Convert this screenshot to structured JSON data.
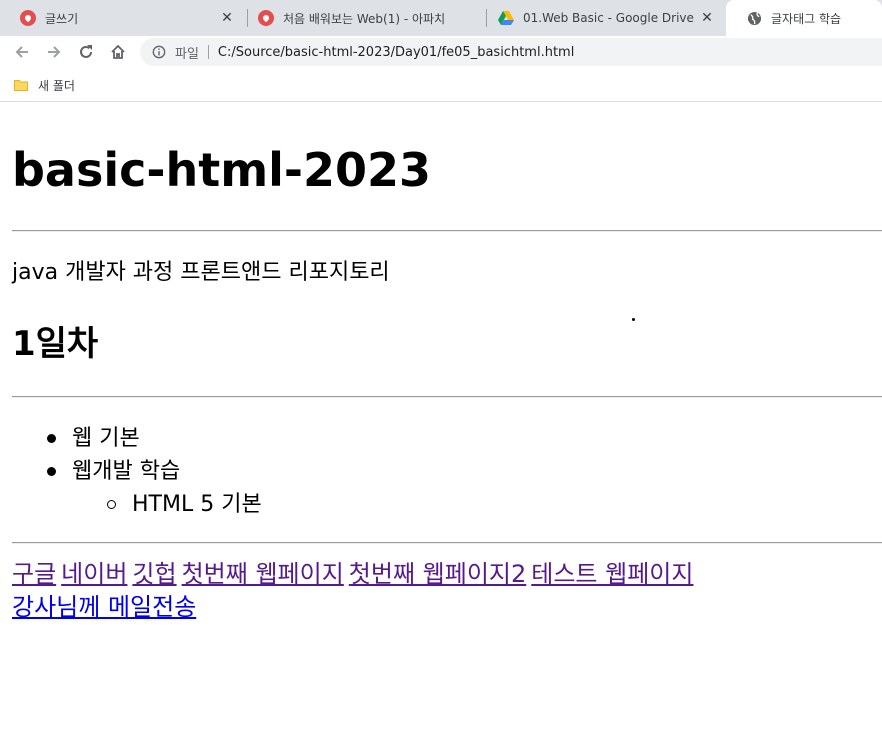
{
  "browser": {
    "tabs": [
      {
        "title": "글쓰기",
        "icon": "tistory-icon",
        "active": false
      },
      {
        "title": "처음 배워보는 Web(1) - 아파치",
        "icon": "tistory-icon",
        "active": false
      },
      {
        "title": "01.Web Basic - Google Drive",
        "icon": "google-drive-icon",
        "active": false
      },
      {
        "title": "글자태그 학습",
        "icon": "globe-icon",
        "active": true
      }
    ],
    "address": {
      "scheme": "파일",
      "url": "C:/Source/basic-html-2023/Day01/fe05_basichtml.html"
    },
    "bookmarks": [
      {
        "label": "새 폴더",
        "icon": "folder-icon"
      }
    ]
  },
  "page": {
    "title": "basic-html-2023",
    "description": "java 개발자 과정 프론트앤드 리포지토리",
    "subtitle": "1일차",
    "list": [
      {
        "text": "웹 기본",
        "level": 1
      },
      {
        "text": "웹개발 학습",
        "level": 1
      },
      {
        "text": "HTML 5 기본",
        "level": 2
      }
    ],
    "links": [
      {
        "text": "구글",
        "visited": true
      },
      {
        "text": "네이버",
        "visited": true
      },
      {
        "text": "깃헙",
        "visited": true
      },
      {
        "text": "첫번째 웹페이지",
        "visited": true
      },
      {
        "text": "첫번째 웹페이지2",
        "visited": true
      },
      {
        "text": "테스트 웹페이지",
        "visited": true
      },
      {
        "text": "강사님께 메일전송",
        "visited": false
      }
    ]
  }
}
